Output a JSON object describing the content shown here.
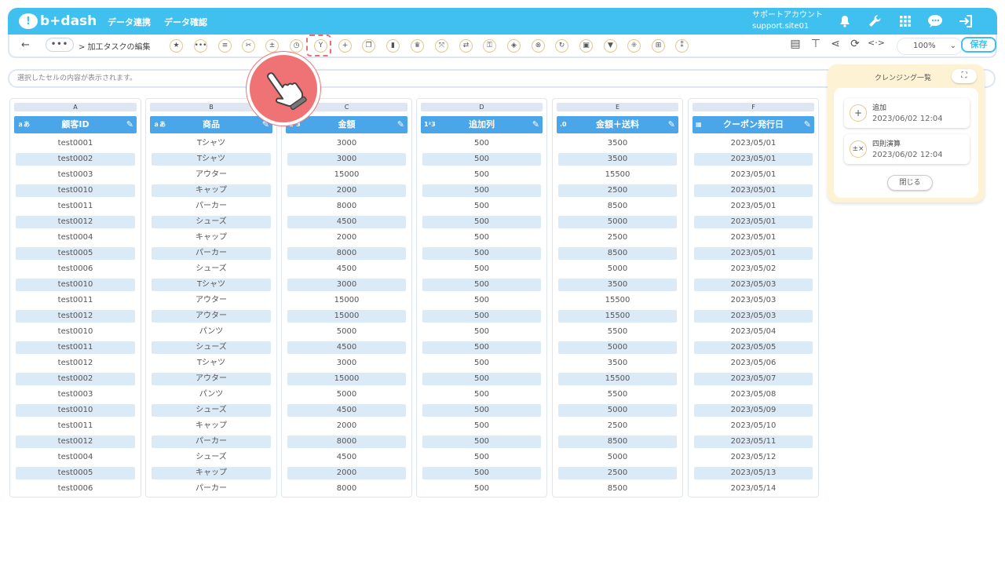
{
  "header": {
    "logo_mark": "!",
    "logo_text": "b+dash",
    "nav": [
      "データ連携",
      "データ確認"
    ],
    "account_name": "サポートアカウント",
    "account_site": "support.site01"
  },
  "toolbar": {
    "back": "←",
    "more": "•••",
    "breadcrumb": "> 加工タスクの編集",
    "zoom": "100%",
    "save": "保存"
  },
  "cell_display": {
    "placeholder": "選択したセルの内容が表示されます。"
  },
  "columns": [
    {
      "letter": "A",
      "type_icon": "ａあ",
      "name": "顧客ID",
      "values": [
        "test0001",
        "test0002",
        "test0003",
        "test0010",
        "test0011",
        "test0012",
        "test0004",
        "test0005",
        "test0006",
        "test0010",
        "test0011",
        "test0012",
        "test0010",
        "test0011",
        "test0012",
        "test0002",
        "test0003",
        "test0010",
        "test0011",
        "test0012",
        "test0004",
        "test0005",
        "test0006"
      ]
    },
    {
      "letter": "B",
      "type_icon": "ａあ",
      "name": "商品",
      "values": [
        "Tシャツ",
        "Tシャツ",
        "アウター",
        "キャップ",
        "パーカー",
        "シューズ",
        "キャップ",
        "パーカー",
        "シューズ",
        "Tシャツ",
        "アウター",
        "アウター",
        "パンツ",
        "シューズ",
        "Tシャツ",
        "アウター",
        "パンツ",
        "シューズ",
        "キャップ",
        "パーカー",
        "シューズ",
        "キャップ",
        "パーカー"
      ]
    },
    {
      "letter": "C",
      "type_icon": "1²3",
      "name": "金額",
      "values": [
        "3000",
        "3000",
        "15000",
        "2000",
        "8000",
        "4500",
        "2000",
        "8000",
        "4500",
        "3000",
        "15000",
        "15000",
        "5000",
        "4500",
        "3000",
        "15000",
        "5000",
        "4500",
        "2000",
        "8000",
        "4500",
        "2000",
        "8000"
      ]
    },
    {
      "letter": "D",
      "type_icon": "1²3",
      "name": "追加列",
      "values": [
        "500",
        "500",
        "500",
        "500",
        "500",
        "500",
        "500",
        "500",
        "500",
        "500",
        "500",
        "500",
        "500",
        "500",
        "500",
        "500",
        "500",
        "500",
        "500",
        "500",
        "500",
        "500",
        "500"
      ]
    },
    {
      "letter": "E",
      "type_icon": ".0",
      "name": "金額＋送料",
      "values": [
        "3500",
        "3500",
        "15500",
        "2500",
        "8500",
        "5000",
        "2500",
        "8500",
        "5000",
        "3500",
        "15500",
        "15500",
        "5500",
        "5000",
        "3500",
        "15500",
        "5500",
        "5000",
        "2500",
        "8500",
        "5000",
        "2500",
        "8500"
      ]
    },
    {
      "letter": "F",
      "type_icon": "▦",
      "name": "クーポン発行日",
      "values": [
        "2023/05/01",
        "2023/05/01",
        "2023/05/01",
        "2023/05/01",
        "2023/05/01",
        "2023/05/01",
        "2023/05/01",
        "2023/05/01",
        "2023/05/02",
        "2023/05/03",
        "2023/05/03",
        "2023/05/03",
        "2023/05/04",
        "2023/05/05",
        "2023/05/06",
        "2023/05/07",
        "2023/05/08",
        "2023/05/09",
        "2023/05/10",
        "2023/05/11",
        "2023/05/12",
        "2023/05/13",
        "2023/05/14"
      ]
    }
  ],
  "cleansing_panel": {
    "title": "クレンジング一覧",
    "items": [
      {
        "icon": "+",
        "name": "追加",
        "date": "2023/06/02 12:04"
      },
      {
        "icon": "±×",
        "name": "四則演算",
        "date": "2023/06/02 12:04"
      }
    ],
    "close": "閉じる"
  },
  "colors": {
    "brand": "#3fc0ee",
    "column_header": "#4aa6e8",
    "row_alt": "#dbeaf7",
    "highlight": "#ee6f73",
    "panel_bg": "#fdf3d4"
  }
}
